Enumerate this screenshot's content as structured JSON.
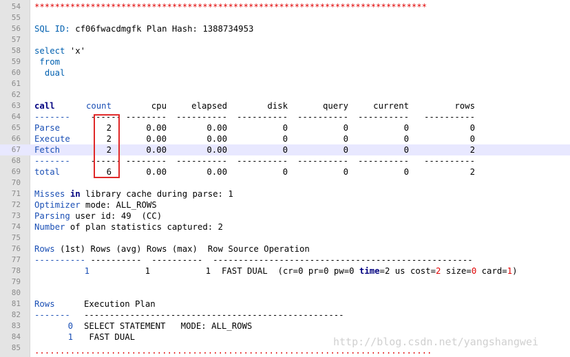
{
  "line_numbers": [
    "54",
    "55",
    "56",
    "57",
    "58",
    "59",
    "60",
    "61",
    "62",
    "63",
    "64",
    "65",
    "66",
    "67",
    "68",
    "69",
    "70",
    "71",
    "72",
    "73",
    "74",
    "75",
    "76",
    "77",
    "78",
    "79",
    "80",
    "81",
    "82",
    "83",
    "84",
    "85"
  ],
  "stars": "*****************************************************************************",
  "stars_bottom": "..............................................................................",
  "sql_id": {
    "label": "SQL ID:",
    "value": "cf06fwacdmgfk",
    "plan_label": "Plan Hash:",
    "plan_value": "1388734953"
  },
  "query": {
    "select": "select",
    "select_arg": "'x'",
    "from": "from",
    "table": "dual"
  },
  "table": {
    "headers": [
      "call",
      "count",
      "cpu",
      "elapsed",
      "disk",
      "query",
      "current",
      "rows"
    ],
    "separator": [
      "-------",
      "------",
      "--------",
      "----------",
      "----------",
      "----------",
      "----------",
      "----------"
    ],
    "rows": [
      [
        "Parse",
        "2",
        "0.00",
        "0.00",
        "0",
        "0",
        "0",
        "0"
      ],
      [
        "Execute",
        "2",
        "0.00",
        "0.00",
        "0",
        "0",
        "0",
        "0"
      ],
      [
        "Fetch",
        "2",
        "0.00",
        "0.00",
        "0",
        "0",
        "0",
        "2"
      ]
    ],
    "total": [
      "total",
      "6",
      "0.00",
      "0.00",
      "0",
      "0",
      "0",
      "2"
    ]
  },
  "stats": {
    "misses": {
      "w1": "Misses",
      "w2": "in",
      "rest": "library cache during parse: 1"
    },
    "optimizer": {
      "w1": "Optimizer",
      "rest": "mode: ALL_ROWS"
    },
    "parsing": {
      "w1": "Parsing",
      "rest": "user id: 49  (CC)"
    },
    "number": {
      "w1": "Number",
      "rest": "of plan statistics captured: 2"
    }
  },
  "row_source": {
    "h1": "Rows",
    "h2": "(1st) Rows (avg) Rows (max)  Row Source Operation",
    "sep1": "----------",
    "sep2": "----------  ----------  ---------------------------------------------------",
    "v1": "1",
    "v2": "1",
    "v3": "1",
    "op": "FAST DUAL",
    "detail_open": "(cr=0 pr=0 pw=0",
    "time_kw": "time",
    "detail_mid": "=2 us cost=",
    "cost_val": "2",
    "size_txt": "size=",
    "size_val": "0",
    "card_txt": "card=",
    "card_val": "1",
    "close": ")"
  },
  "exec_plan": {
    "h1": "Rows",
    "h2": "Execution Plan",
    "sep1": "-------",
    "sep2": "---------------------------------------------------",
    "r1_num": "0",
    "r1_text": "SELECT STATEMENT   MODE: ALL_ROWS",
    "r2_num": "1",
    "r2_text": " FAST DUAL"
  },
  "watermark": "http://blog.csdn.net/yangshangwei"
}
